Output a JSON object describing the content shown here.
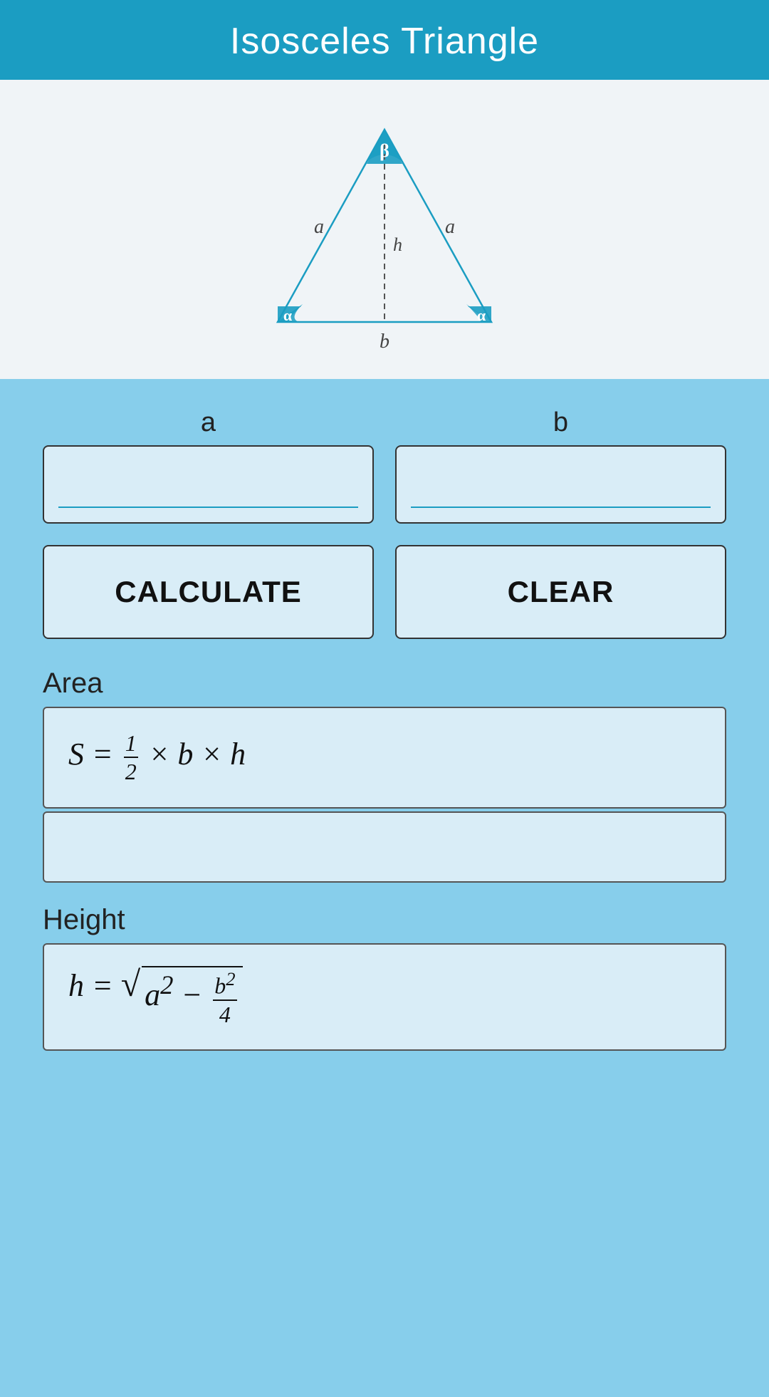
{
  "header": {
    "title": "Isosceles Triangle"
  },
  "diagram": {
    "labels": {
      "apex_angle": "β",
      "base_angle_left": "α",
      "base_angle_right": "α",
      "side_left": "a",
      "side_right": "a",
      "base": "b",
      "height": "h"
    }
  },
  "form": {
    "input_a_label": "a",
    "input_b_label": "b",
    "input_a_placeholder": "",
    "input_b_placeholder": "",
    "calculate_button": "CALCULATE",
    "clear_button": "CLEAR"
  },
  "area_section": {
    "label": "Area",
    "formula": "S = ½ × b × h",
    "formula_display": "S = (1/2) × b × h",
    "result": ""
  },
  "height_section": {
    "label": "Height",
    "formula": "h = √(a² - b²/4)",
    "formula_display": "h = √[a² − b²/4]",
    "result": ""
  },
  "colors": {
    "header_bg": "#1B9DC2",
    "teal": "#1B9DC2",
    "light_blue": "#87CEEB",
    "input_bg": "#d9edf7",
    "diagram_bg": "#f0f4f7"
  }
}
